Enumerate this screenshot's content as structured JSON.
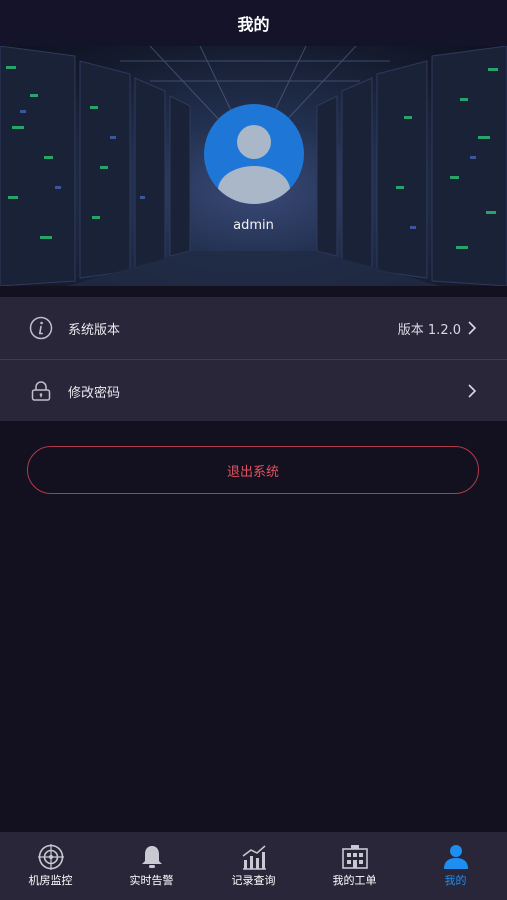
{
  "header": {
    "title": "我的"
  },
  "profile": {
    "username": "admin"
  },
  "menu": {
    "items": [
      {
        "icon": "info-icon",
        "label": "系统版本",
        "value": "版本 1.2.0"
      },
      {
        "icon": "lock-icon",
        "label": "修改密码",
        "value": ""
      }
    ]
  },
  "logout": {
    "label": "退出系统"
  },
  "tabbar": {
    "items": [
      {
        "icon": "target-icon",
        "label": "机房监控",
        "active": false
      },
      {
        "icon": "bell-icon",
        "label": "实时告警",
        "active": false
      },
      {
        "icon": "chart-icon",
        "label": "记录查询",
        "active": false
      },
      {
        "icon": "building-icon",
        "label": "我的工单",
        "active": false
      },
      {
        "icon": "user-icon",
        "label": "我的",
        "active": true
      }
    ]
  },
  "colors": {
    "accent": "#1e8ef0",
    "danger": "#e0525e",
    "background": "#13111f",
    "panel": "#282638"
  }
}
